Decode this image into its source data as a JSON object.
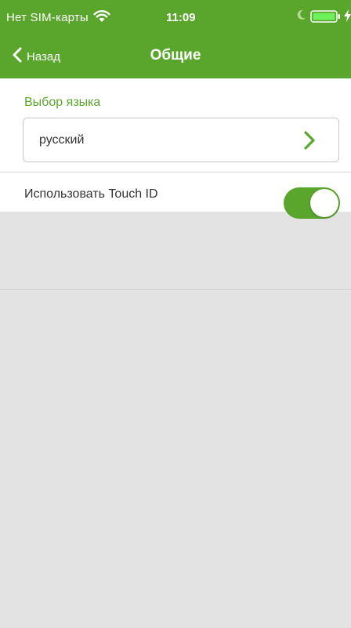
{
  "status_bar": {
    "carrier": "Нет SIM-карты",
    "time": "11:09",
    "icons": [
      "wifi-icon",
      "moon-icon",
      "battery-icon",
      "charging-bolt-icon"
    ]
  },
  "nav": {
    "back_label": "Назад",
    "title": "Общие"
  },
  "settings": {
    "language_section_label": "Выбор языка",
    "language_value": "русский",
    "touch_id_label": "Использовать Touch ID",
    "touch_id_enabled": true
  },
  "colors": {
    "accent": "#5aa62c",
    "background": "#e3e3e3",
    "panel": "#ffffff"
  }
}
